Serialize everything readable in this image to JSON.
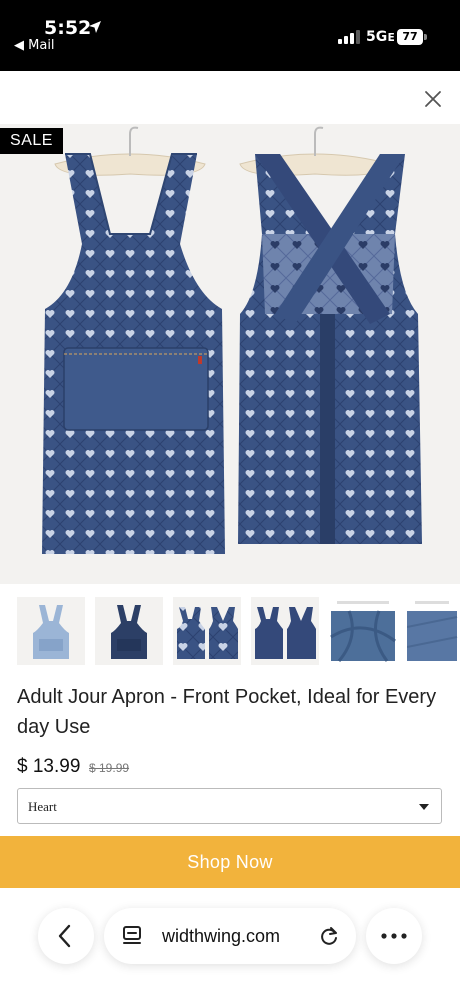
{
  "status_bar": {
    "time": "5:52",
    "back_app": "◀ Mail",
    "network": "5Gᴇ",
    "battery": "77"
  },
  "product": {
    "sale_badge": "SALE",
    "title": "Adult Jour Apron - Front Pocket, Ideal for Everyday Use",
    "price": "$ 13.99",
    "old_price": "$ 19.99",
    "variant_selected": "Heart",
    "cta": "Shop Now"
  },
  "thumbnails": [
    {
      "alt": "light-denim-apron"
    },
    {
      "alt": "dark-denim-apron"
    },
    {
      "alt": "heart-apron-front-back"
    },
    {
      "alt": "heart-apron-front-back-2"
    },
    {
      "alt": "denim-fabric-closeup"
    },
    {
      "alt": "denim-fabric-detail"
    }
  ],
  "browser": {
    "url": "widthwing.com"
  },
  "colors": {
    "accent": "#f2b33c",
    "denim": "#3a5384",
    "denim_dark": "#2f4672"
  }
}
